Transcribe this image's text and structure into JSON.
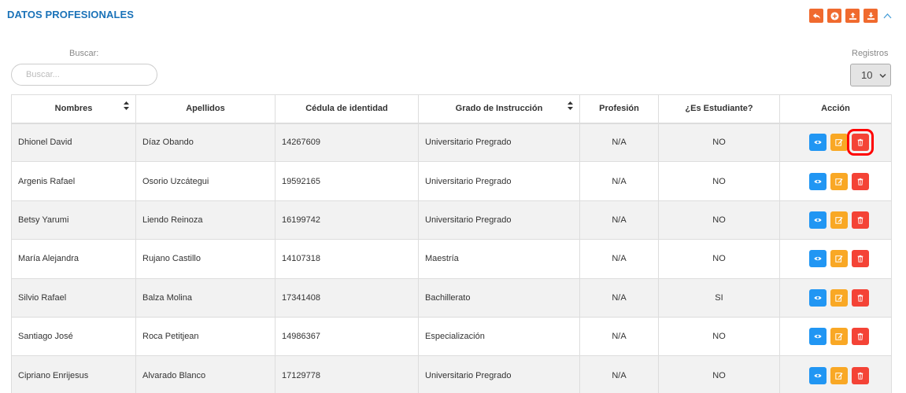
{
  "title": "DATOS PROFESIONALES",
  "toolbar": {
    "buttons": [
      "undo-icon",
      "add-icon",
      "upload-icon",
      "download-icon"
    ],
    "accent": "#f06a2e",
    "collapse_icon": "chevron-up-icon"
  },
  "search": {
    "label": "Buscar:",
    "placeholder": "Buscar..."
  },
  "registros": {
    "label": "Registros",
    "value": "10"
  },
  "table": {
    "headers": [
      "Nombres",
      "Apellidos",
      "Cédula de identidad",
      "Grado de Instrucción",
      "Profesión",
      "¿Es Estudiante?",
      "Acción"
    ],
    "rows": [
      [
        "Dhionel David",
        "Díaz Obando",
        "14267609",
        "Universitario Pregrado",
        "N/A",
        "NO"
      ],
      [
        "Argenis Rafael",
        "Osorio Uzcátegui",
        "19592165",
        "Universitario Pregrado",
        "N/A",
        "NO"
      ],
      [
        "Betsy Yarumi",
        "Liendo Reinoza",
        "16199742",
        "Universitario Pregrado",
        "N/A",
        "NO"
      ],
      [
        "María Alejandra",
        "Rujano Castillo",
        "14107318",
        "Maestría",
        "N/A",
        "NO"
      ],
      [
        "Silvio Rafael",
        "Balza Molina",
        "17341408",
        "Bachillerato",
        "N/A",
        "SI"
      ],
      [
        "Santiago José",
        "Roca Petitjean",
        "14986367",
        "Especialización",
        "N/A",
        "NO"
      ],
      [
        "Cipriano Enrijesus",
        "Alvarado Blanco",
        "17129778",
        "Universitario Pregrado",
        "N/A",
        "NO"
      ]
    ],
    "action_colors": {
      "view": "#2196f3",
      "edit": "#f9a825",
      "delete": "#f44336"
    },
    "highlighted_delete_row": 0
  }
}
